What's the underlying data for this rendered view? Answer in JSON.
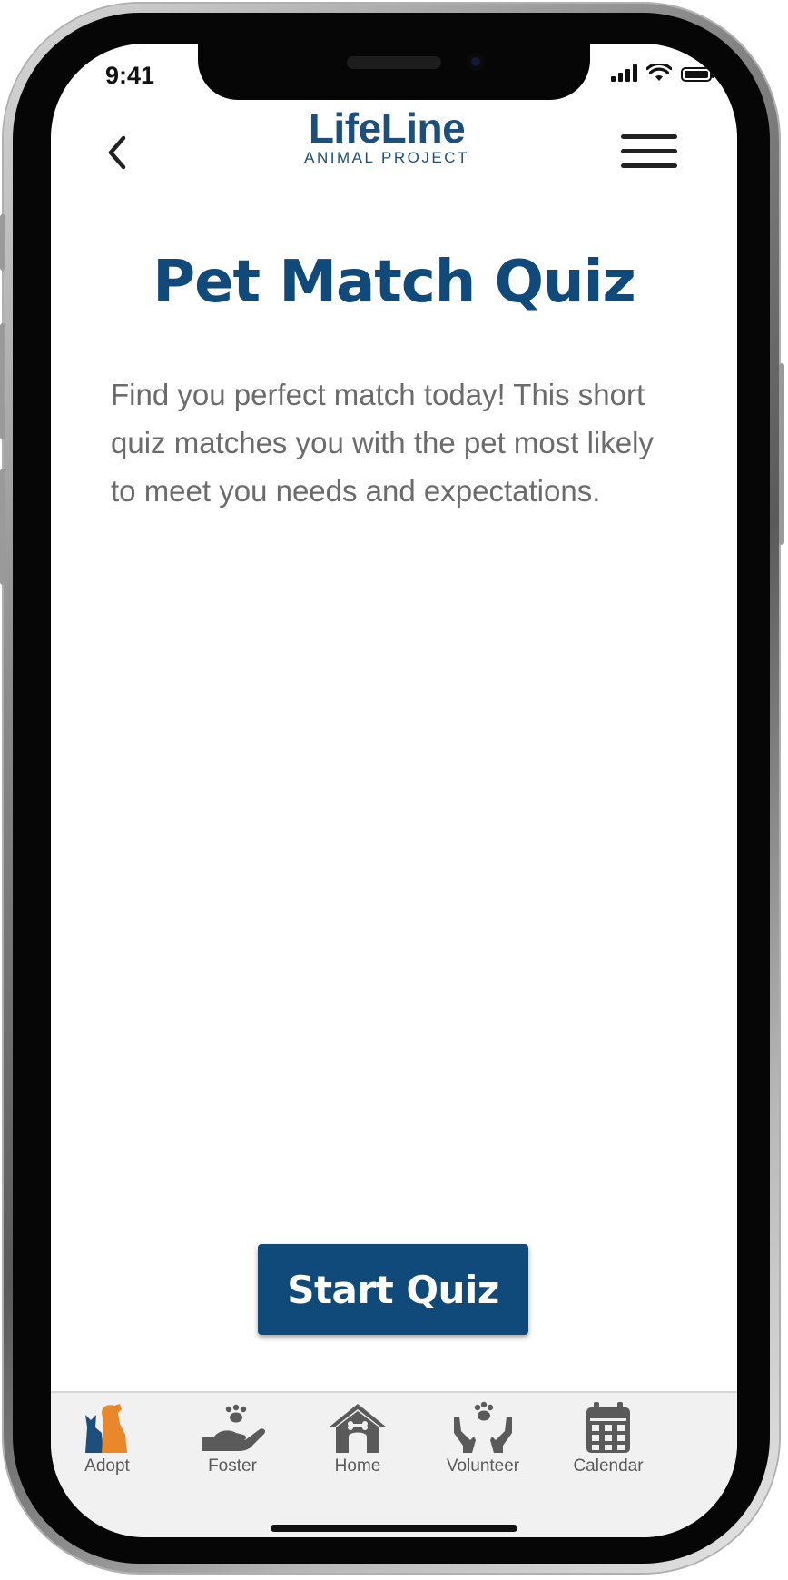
{
  "status_bar": {
    "time": "9:41"
  },
  "header": {
    "logo_main": "LifeLine",
    "logo_sub": "ANIMAL PROJECT"
  },
  "main": {
    "title": "Pet Match Quiz",
    "description": "Find you perfect match today! This short quiz matches you with the pet most likely to meet you needs and expectations.",
    "start_button": "Start Quiz"
  },
  "tabbar": {
    "items": [
      {
        "label": "Adopt",
        "icon": "cat-dog-icon",
        "active": true
      },
      {
        "label": "Foster",
        "icon": "hand-paw-icon",
        "active": false
      },
      {
        "label": "Home",
        "icon": "doghouse-icon",
        "active": false
      },
      {
        "label": "Volunteer",
        "icon": "hands-paw-icon",
        "active": false
      },
      {
        "label": "Calendar",
        "icon": "calendar-icon",
        "active": false
      }
    ]
  },
  "colors": {
    "brand_blue": "#0f4a7a",
    "accent_orange": "#e8882b",
    "tab_icon_gray": "#5a5a5a"
  }
}
